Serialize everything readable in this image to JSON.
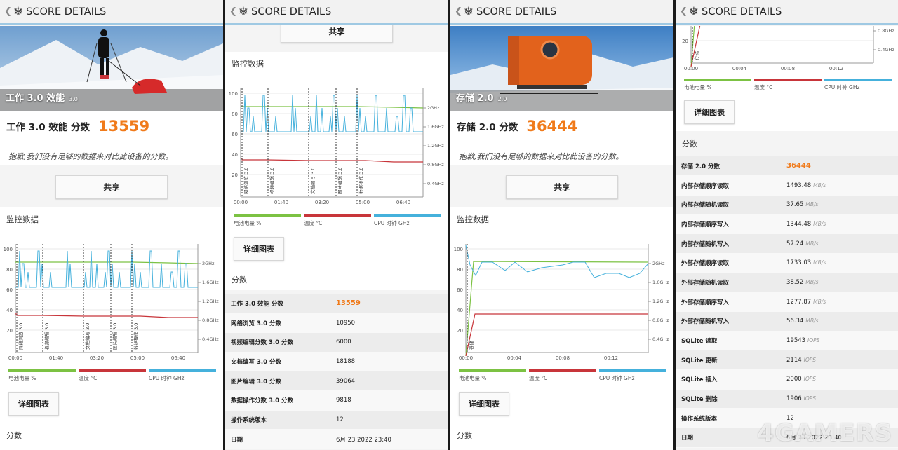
{
  "header_title": "SCORE DETAILS",
  "panel1": {
    "banner_title": "工作 3.0 效能",
    "banner_version": "3.0",
    "score_label": "工作 3.0 效能 分数",
    "score_value": "13559",
    "sorry_text": "抱歉,我们没有足够的数据来对比此设备的分数。",
    "share_label": "共享",
    "monitor_title": "监控数据",
    "detail_label": "详细图表",
    "scores_title": "分数"
  },
  "panel2": {
    "share_label": "共享",
    "monitor_title": "监控数据",
    "detail_label": "详细图表",
    "scores_title": "分数",
    "rows": [
      {
        "k": "工作 3.0 效能 分数",
        "v": "13559",
        "accent": true
      },
      {
        "k": "网络浏览 3.0 分数",
        "v": "10950"
      },
      {
        "k": "视频编辑分数 3.0 分数",
        "v": "6000"
      },
      {
        "k": "文档编写 3.0 分数",
        "v": "18188"
      },
      {
        "k": "图片编辑 3.0 分数",
        "v": "39064"
      },
      {
        "k": "数据操作分数 3.0 分数",
        "v": "9818"
      },
      {
        "k": "操作系统版本",
        "v": "12"
      },
      {
        "k": "日期",
        "v": "6月 23 2022 23:40"
      }
    ]
  },
  "panel3": {
    "banner_title": "存储 2.0",
    "banner_version": "2.0",
    "score_label": "存储 2.0 分数",
    "score_value": "36444",
    "sorry_text": "抱歉,我们没有足够的数据来对比此设备的分数。",
    "share_label": "共享",
    "monitor_title": "监控数据",
    "detail_label": "详细图表",
    "scores_title": "分数"
  },
  "panel4": {
    "detail_label": "详细图表",
    "scores_title": "分数",
    "rows": [
      {
        "k": "存储 2.0 分数",
        "v": "36444",
        "u": "",
        "accent": true
      },
      {
        "k": "内部存储顺序读取",
        "v": "1493.48",
        "u": "MB/s"
      },
      {
        "k": "内部存储随机读取",
        "v": "37.65",
        "u": "MB/s"
      },
      {
        "k": "内部存储顺序写入",
        "v": "1344.48",
        "u": "MB/s"
      },
      {
        "k": "内部存储随机写入",
        "v": "57.24",
        "u": "MB/s"
      },
      {
        "k": "外部存储顺序读取",
        "v": "1733.03",
        "u": "MB/s"
      },
      {
        "k": "外部存储随机读取",
        "v": "38.52",
        "u": "MB/s"
      },
      {
        "k": "外部存储顺序写入",
        "v": "1277.87",
        "u": "MB/s"
      },
      {
        "k": "外部存储随机写入",
        "v": "56.34",
        "u": "MB/s"
      },
      {
        "k": "SQLite 读取",
        "v": "19543",
        "u": "IOPS"
      },
      {
        "k": "SQLite 更新",
        "v": "2114",
        "u": "IOPS"
      },
      {
        "k": "SQLite 插入",
        "v": "2000",
        "u": "IOPS"
      },
      {
        "k": "SQLite 删除",
        "v": "1906",
        "u": "IOPS"
      },
      {
        "k": "操作系统版本",
        "v": "12",
        "u": ""
      },
      {
        "k": "日期",
        "v": "6月 23 2022 23:40",
        "u": ""
      }
    ]
  },
  "legend": {
    "battery": "电池电量 %",
    "temp": "温度 °C",
    "cpu": "CPU 时钟 GHz"
  },
  "colors": {
    "battery": "#7cc243",
    "temp": "#c8353a",
    "cpu": "#45b1dc",
    "accent": "#f07a1a"
  },
  "watermark": "4GAMERS",
  "chart_data": [
    {
      "type": "line",
      "chart": "work",
      "y_ticks": [
        "100",
        "80",
        "60",
        "40",
        "20"
      ],
      "x_ticks": [
        "00:00",
        "01:40",
        "03:20",
        "05:00",
        "06:40"
      ],
      "right_ticks": [
        "2GHz",
        "1.6GHz",
        "1.2GHz",
        "0.8GHz",
        "0.4GHz"
      ],
      "markers": [
        "网络浏览 3.0",
        "视频编辑 3.0",
        "文档编写 3.0",
        "图片编辑 3.0",
        "数据操作 3.0"
      ]
    },
    {
      "type": "line",
      "chart": "storage",
      "y_ticks": [
        "100",
        "80",
        "60",
        "40",
        "20"
      ],
      "x_ticks": [
        "00:00",
        "00:04",
        "00:08",
        "00:12"
      ],
      "right_ticks": [
        "2GHz",
        "1.6GHz",
        "1.2GHz",
        "0.8GHz",
        "0.4GHz"
      ],
      "markers": [
        "存储"
      ]
    }
  ]
}
